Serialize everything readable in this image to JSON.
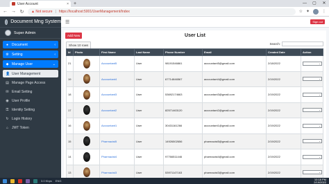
{
  "browser": {
    "tab_title": "User Account",
    "tab_close": "×",
    "new_tab": "+",
    "security": "Not secure",
    "url": "https://localhost:5001/UserManagement/Index",
    "controls": {
      "minimize": "—",
      "maximize": "▢",
      "close": "✕"
    }
  },
  "sidebar": {
    "brand": "Document Mng System",
    "username": "Super Admin",
    "menu": [
      {
        "label": "Document",
        "icon": "●",
        "active": true
      },
      {
        "label": "Setting",
        "icon": "⚙",
        "active": true
      },
      {
        "label": "Manage User",
        "icon": "◆",
        "active": true
      }
    ],
    "subitems": [
      {
        "label": "User Management",
        "icon": "👤",
        "current": true
      },
      {
        "label": "Manage Page Access",
        "icon": "▤",
        "current": false
      },
      {
        "label": "Email Setting",
        "icon": "✉",
        "current": false
      },
      {
        "label": "User Profile",
        "icon": "◉",
        "current": false
      },
      {
        "label": "Identity Setting",
        "icon": "⚿",
        "current": false
      },
      {
        "label": "Login History",
        "icon": "↻",
        "current": false
      },
      {
        "label": "JWT Token",
        "icon": "⌂",
        "current": false
      }
    ]
  },
  "header": {
    "signout": "Sign out"
  },
  "main": {
    "add_new": "Add New",
    "title": "User List",
    "show_rows": "Show 10 rows",
    "search_label": "Search:",
    "columns": [
      "Id",
      "Photo",
      "First Name",
      "Last Name",
      "Phone Number",
      "Email",
      "Created Date",
      "Action"
    ],
    "rows": [
      {
        "id": "21",
        "first": "Accountant5",
        "last": "User",
        "phone": "98191546861",
        "email": "accountant5@gmail.com",
        "date": "2/18/2022"
      },
      {
        "id": "19",
        "first": "Accountant4",
        "last": "User",
        "phone": "67714846567",
        "email": "accountant4@gmail.com",
        "date": "2/19/2022"
      },
      {
        "id": "18",
        "first": "Accountant3",
        "last": "User",
        "phone": "53692174663",
        "email": "accountant3@gmail.com",
        "date": "2/19/2022"
      },
      {
        "id": "17",
        "first": "Accountant2",
        "last": "User",
        "phone": "82571463120",
        "email": "accountant2@gmail.com",
        "date": "2/19/2022"
      },
      {
        "id": "16",
        "first": "Accountant1",
        "last": "User",
        "phone": "30431161266",
        "email": "accountant1@gmail.com",
        "date": "2/19/2022"
      },
      {
        "id": "15",
        "first": "Pharmacist5",
        "last": "User",
        "phone": "14926502656",
        "email": "pharmacist5@gmail.com",
        "date": "2/19/2022"
      },
      {
        "id": "14",
        "first": "Pharmacist4",
        "last": "User",
        "phone": "97766511446",
        "email": "pharmacist4@gmail.com",
        "date": "2/19/2022"
      },
      {
        "id": "13",
        "first": "Pharmacist3",
        "last": "User",
        "phone": "53971147163",
        "email": "pharmacist3@gmail.com",
        "date": "2/19/2022"
      }
    ]
  },
  "taskbar": {
    "time": "10:18 PM",
    "date": "2/19/2022",
    "lang": "ENG",
    "net": "3.0 Kbps"
  }
}
